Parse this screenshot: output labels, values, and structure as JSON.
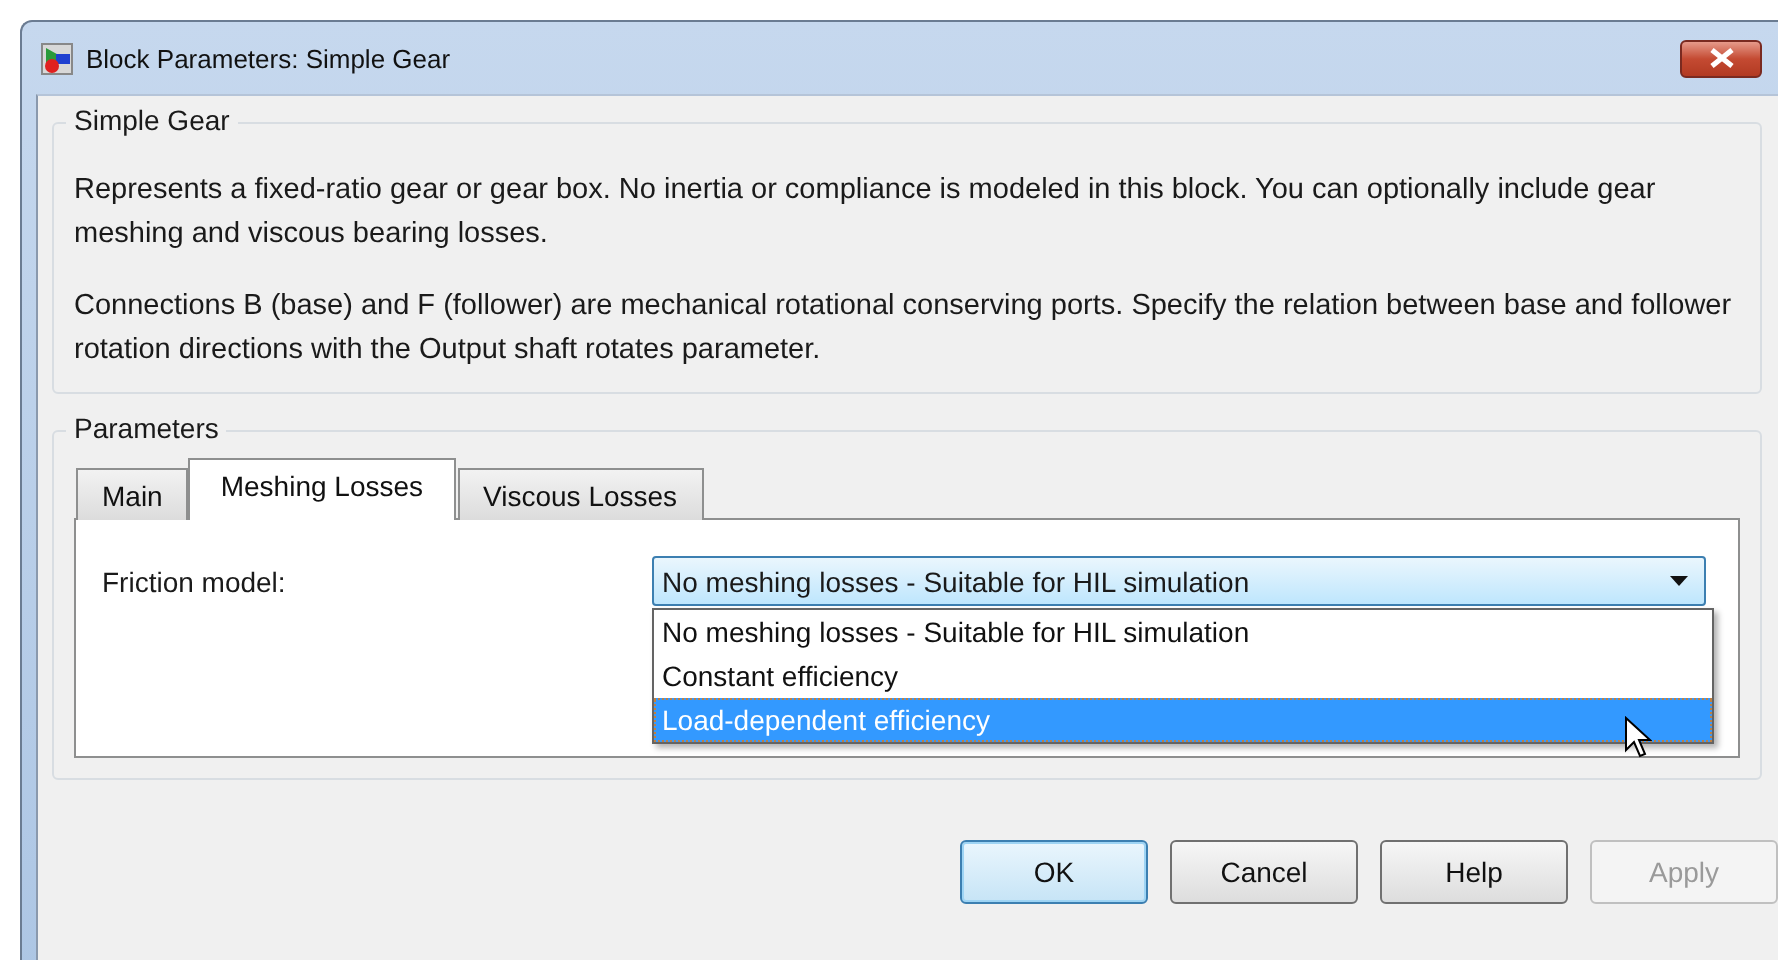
{
  "window": {
    "title": "Block Parameters: Simple Gear"
  },
  "description": {
    "title": "Simple Gear",
    "paragraphs": [
      "Represents a fixed-ratio gear or gear box. No inertia or compliance is modeled in this block. You can optionally include gear meshing and viscous bearing losses.",
      "Connections B (base) and F (follower) are mechanical rotational conserving ports. Specify the relation between base and follower rotation directions with the Output shaft rotates parameter."
    ]
  },
  "parameters": {
    "title": "Parameters",
    "tabs": [
      {
        "label": "Main",
        "selected": false
      },
      {
        "label": "Meshing Losses",
        "selected": true
      },
      {
        "label": "Viscous Losses",
        "selected": false
      }
    ],
    "friction_model": {
      "label": "Friction model:",
      "value": "No meshing losses - Suitable for HIL simulation",
      "expanded": true,
      "options": [
        {
          "label": "No meshing losses - Suitable for HIL simulation",
          "highlighted": false
        },
        {
          "label": "Constant efficiency",
          "highlighted": false
        },
        {
          "label": "Load-dependent efficiency",
          "highlighted": true
        }
      ]
    }
  },
  "buttons": [
    {
      "label": "OK",
      "default": true,
      "disabled": false
    },
    {
      "label": "Cancel",
      "default": false,
      "disabled": false
    },
    {
      "label": "Help",
      "default": false,
      "disabled": false
    },
    {
      "label": "Apply",
      "default": false,
      "disabled": true
    }
  ]
}
